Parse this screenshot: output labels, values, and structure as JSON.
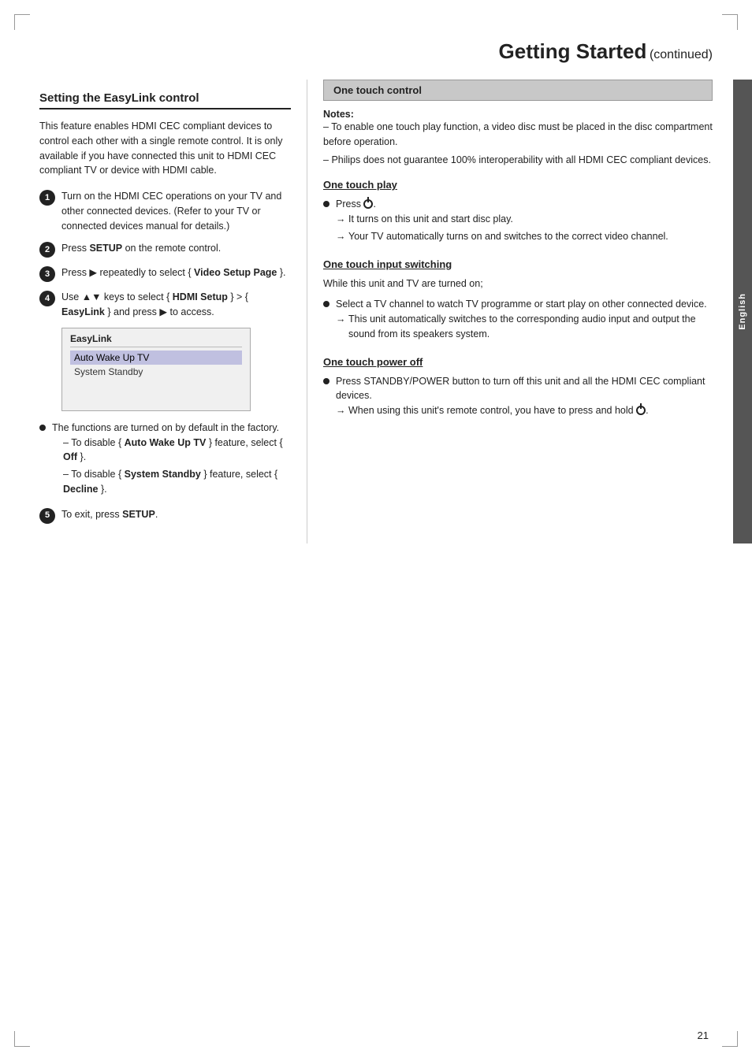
{
  "page": {
    "title": "Getting Started",
    "title_continued": "(continued)",
    "page_number": "21",
    "english_label": "English"
  },
  "left": {
    "section_heading": "Setting the EasyLink control",
    "intro_text": "This feature enables HDMI CEC compliant devices to control each other with a single remote control. It is only available if you have connected this unit to HDMI CEC compliant TV or device with HDMI cable.",
    "steps": [
      {
        "number": "1",
        "text": "Turn on the HDMI CEC operations on your TV and other connected devices. (Refer to your TV or connected devices manual for details.)"
      },
      {
        "number": "2",
        "text_plain": "Press ",
        "text_bold": "SETUP",
        "text_after": " on the remote control."
      },
      {
        "number": "3",
        "text_plain": "Press ▶ repeatedly to select { ",
        "text_bold": "Video Setup Page",
        "text_after": " }."
      },
      {
        "number": "4",
        "text_plain": "Use ▲▼ keys to select { ",
        "text_bold": "HDMI Setup",
        "text_middle": " } > { ",
        "text_bold2": "EasyLink",
        "text_after": " } and press ▶ to access."
      }
    ],
    "screenshot": {
      "title": "EasyLink",
      "items": [
        "Auto Wake Up TV",
        "System Standby"
      ]
    },
    "bullets": [
      {
        "text": "The functions are turned on by default in the factory.",
        "sub_items": [
          "To disable { Auto Wake Up TV } feature, select { Off }.",
          "To disable { System Standby } feature, select { Decline }."
        ]
      }
    ],
    "step5": {
      "number": "5",
      "text_plain": "To exit, press ",
      "text_bold": "SETUP",
      "text_after": "."
    }
  },
  "right": {
    "one_touch_header": "One touch control",
    "notes_label": "Notes:",
    "notes_items": [
      "To enable one touch play function, a video disc must be placed in the disc compartment before operation.",
      "Philips does not guarantee 100% interoperability with all HDMI CEC compliant devices."
    ],
    "one_touch_play": {
      "heading": "One touch play",
      "bullet": "Press",
      "power_symbol": "⏻",
      "arrow_items": [
        "It turns on this unit and start disc play.",
        "Your TV automatically turns on and switches to the correct video channel."
      ]
    },
    "one_touch_input": {
      "heading": "One touch input switching",
      "sub_heading": "While this unit and TV are turned on;",
      "bullet": "Select a TV channel to watch TV programme or start play on other connected device.",
      "arrow_items": [
        "This unit automatically switches to the corresponding audio input and output the sound from its speakers system."
      ]
    },
    "one_touch_power": {
      "heading": "One touch power off",
      "bullet": "Press STANDBY/POWER button to turn off this unit and all the HDMI CEC compliant devices.",
      "arrow_items": [
        "When using this unit's remote control, you have to press and hold"
      ],
      "arrow_end": "."
    }
  }
}
